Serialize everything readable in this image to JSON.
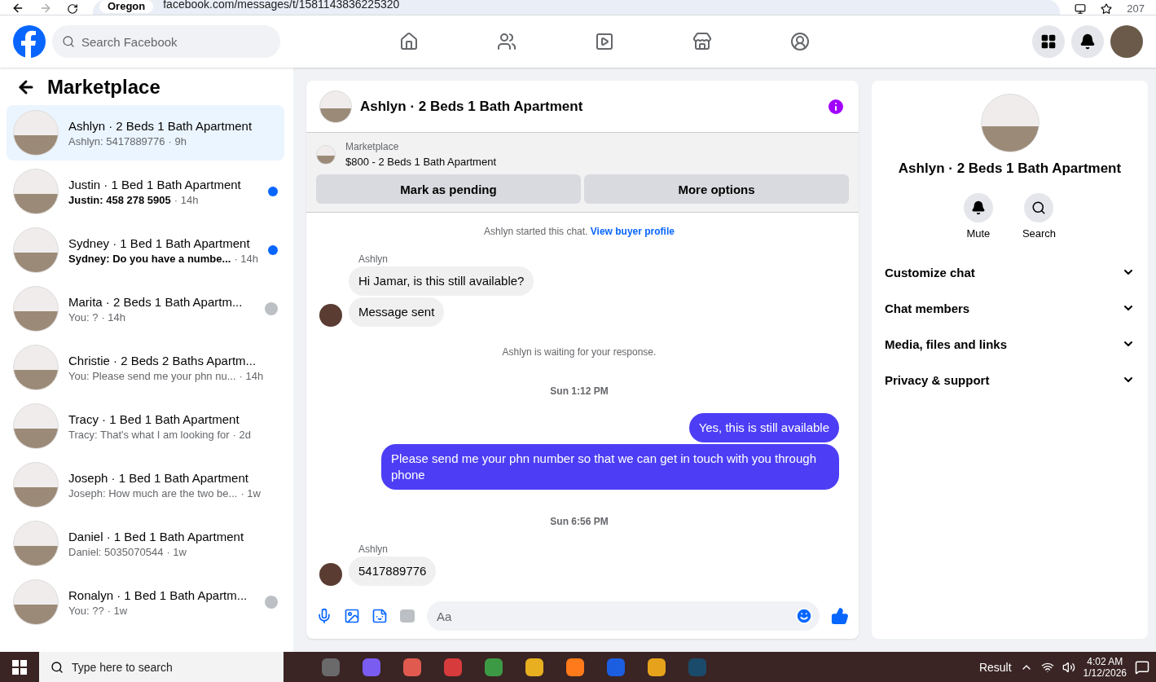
{
  "browser": {
    "location_chip": "Oregon",
    "url": "facebook.com/messages/t/1581143836225320",
    "profile_count": "207"
  },
  "header": {
    "search": {
      "placeholder": "Search Facebook"
    },
    "nav": [
      {
        "kind": "home",
        "selected": false
      },
      {
        "kind": "friends",
        "selected": false
      },
      {
        "kind": "video",
        "selected": false
      },
      {
        "kind": "marketplace",
        "selected": false
      },
      {
        "kind": "groups",
        "selected": false
      }
    ]
  },
  "sidebar": {
    "title": "Marketplace",
    "conversations": [
      {
        "name": "Ashlyn · 2 Beds 1 Bath Apartment",
        "preview": "Ashlyn: 5417889776",
        "time": "· 9h",
        "unread": false,
        "selected": true,
        "seen": false
      },
      {
        "name": "Justin · 1 Bed 1 Bath Apartment",
        "preview": "Justin: 458 278 5905",
        "time": "· 14h",
        "unread": true,
        "selected": false,
        "seen": false
      },
      {
        "name": "Sydney · 1 Bed 1 Bath Apartment",
        "preview": "Sydney: Do you have a numbe...",
        "time": "· 14h",
        "unread": true,
        "selected": false,
        "seen": false
      },
      {
        "name": "Marita · 2 Beds 1 Bath Apartm...",
        "preview": "You: ?",
        "time": "· 14h",
        "unread": false,
        "selected": false,
        "seen": true
      },
      {
        "name": "Christie · 2 Beds 2 Baths Apartm...",
        "preview": "You: Please send me your phn nu...",
        "time": "· 14h",
        "unread": false,
        "selected": false,
        "seen": false
      },
      {
        "name": "Tracy · 1 Bed 1 Bath Apartment",
        "preview": "Tracy: That's what I am looking for",
        "time": "· 2d",
        "unread": false,
        "selected": false,
        "seen": false
      },
      {
        "name": "Joseph · 1 Bed 1 Bath Apartment",
        "preview": "Joseph: How much are the two be...",
        "time": "· 1w",
        "unread": false,
        "selected": false,
        "seen": false
      },
      {
        "name": "Daniel · 1 Bed 1 Bath Apartment",
        "preview": "Daniel: 5035070544",
        "time": "· 1w",
        "unread": false,
        "selected": false,
        "seen": false
      },
      {
        "name": "Ronalyn · 1 Bed 1 Bath Apartm...",
        "preview": "You: ??",
        "time": "· 1w",
        "unread": false,
        "selected": false,
        "seen": true
      }
    ]
  },
  "chat": {
    "title": "Ashlyn · 2 Beds 1 Bath Apartment",
    "listing": {
      "label": "Marketplace",
      "title": "$800 - 2 Beds 1 Bath Apartment"
    },
    "actions": [
      "Mark as pending",
      "More options"
    ],
    "messages": [
      {
        "kind": "system",
        "text": "Ashlyn started this chat.",
        "link": "View buyer profile"
      },
      {
        "kind": "incoming",
        "sender": "Ashlyn",
        "bubbles": [
          "Hi Jamar, is this still available?",
          "Message sent"
        ]
      },
      {
        "kind": "system",
        "text": "Ashlyn is waiting for your response."
      },
      {
        "kind": "time",
        "text": "Sun 1:12 PM"
      },
      {
        "kind": "outgoing",
        "bubbles": [
          "Yes, this is still available",
          "Please send me your phn number so that we can get in touch with you through phone"
        ]
      },
      {
        "kind": "time",
        "text": "Sun 6:56 PM"
      },
      {
        "kind": "incoming",
        "sender": "Ashlyn",
        "bubbles": [
          "5417889776"
        ]
      }
    ],
    "composer": {
      "placeholder": "Aa"
    }
  },
  "details": {
    "title": "Ashlyn · 2 Beds 1 Bath Apartment",
    "actions": [
      {
        "kind": "mute",
        "label": "Mute"
      },
      {
        "kind": "search",
        "label": "Search"
      }
    ],
    "sections": [
      "Customize chat",
      "Chat members",
      "Media, files and links",
      "Privacy & support"
    ]
  },
  "taskbar": {
    "search": {
      "placeholder": "Type here to search"
    },
    "weather": "Result",
    "time": "4:02 AM",
    "date": "1/12/2026"
  }
}
